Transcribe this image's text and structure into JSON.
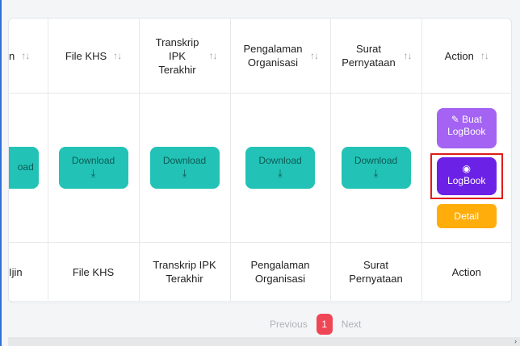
{
  "table": {
    "headers": [
      {
        "label": "n"
      },
      {
        "label": "File KHS"
      },
      {
        "label": "Transkrip IPK Terakhir"
      },
      {
        "label": "Pengalaman Organisasi"
      },
      {
        "label": "Surat Pernyataan"
      },
      {
        "label": "Action"
      }
    ],
    "sort_glyph": "↑↓",
    "row": {
      "cut_download_label": "oad",
      "download_label": "Download",
      "download_icon": "⤓",
      "buat_logbook_icon": "✎",
      "buat_logbook_label": "Buat LogBook",
      "view_icon": "◉",
      "view_logbook_label": "LogBook",
      "detail_label": "Detail"
    },
    "footer": [
      {
        "label": "Ijin"
      },
      {
        "label": "File KHS"
      },
      {
        "label": "Transkrip IPK Terakhir"
      },
      {
        "label": "Pengalaman Organisasi"
      },
      {
        "label": "Surat Pernyataan"
      },
      {
        "label": "Action"
      }
    ]
  },
  "pagination": {
    "previous": "Previous",
    "current": "1",
    "next": "Next"
  },
  "colors": {
    "download": "#22c3b6",
    "buat_logbook": "#a463f2",
    "view_logbook": "#6c22e6",
    "detail": "#ffad0a",
    "highlight": "#e01b1b",
    "page_active": "#ef4656"
  }
}
